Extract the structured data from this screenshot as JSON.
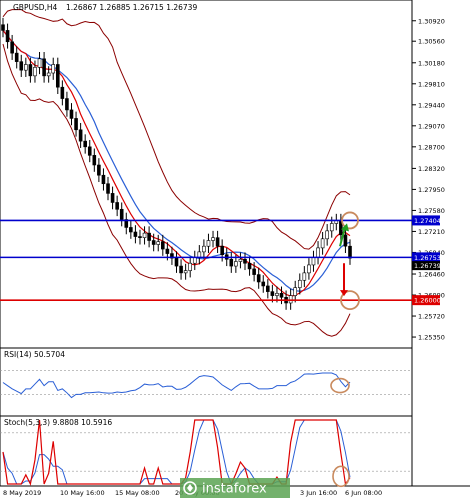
{
  "header": {
    "symbol": "GBPUSD,H4",
    "ohlc": "1.26867 1.26885 1.26715 1.26739"
  },
  "price_panel": {
    "ylim": [
      1.2521,
      1.3118
    ],
    "yticks": [
      "1.30920",
      "1.30560",
      "1.30180",
      "1.29810",
      "1.29440",
      "1.29070",
      "1.28700",
      "1.28320",
      "1.27950",
      "1.27580",
      "1.27210",
      "1.26840",
      "1.26460",
      "1.26090",
      "1.25720",
      "1.25350"
    ],
    "levels": [
      {
        "value": 1.27404,
        "label": "1.27404",
        "color": "#0000cc"
      },
      {
        "value": 1.26753,
        "label": "1.26753",
        "color": "#0000cc"
      },
      {
        "value": 1.26,
        "label": "1.26000",
        "color": "#dd0000"
      }
    ],
    "last_price_label": "1.26739",
    "colors": {
      "bollinger": "#8b0000",
      "ma_fast": "#dd0000",
      "ma_slow": "#2a5fd6",
      "candles": "#000000"
    }
  },
  "rsi_panel": {
    "label": "RSI(14) 50.5704",
    "ylim": [
      0,
      100
    ]
  },
  "stoch_panel": {
    "label": "Stoch(5,3,3) 9.8808 10.5916",
    "ylim": [
      0,
      100
    ],
    "colors": {
      "main": "#dd0000",
      "signal": "#2a5fd6"
    }
  },
  "x_axis": {
    "labels": [
      "8 May 2019",
      "10 May 16:00",
      "15 May 08:00",
      "20 May 00:00",
      "3 Jun 16:00",
      "6 Jun 08:00"
    ]
  },
  "watermark": {
    "text": "instaforex"
  },
  "chart_data": {
    "type": "candlestick",
    "symbol": "GBPUSD",
    "timeframe": "H4",
    "close_series": [
      1.3075,
      1.3055,
      1.3035,
      1.302,
      1.3005,
      1.3015,
      1.2995,
      1.301,
      1.3025,
      1.2995,
      1.3,
      1.3015,
      1.2975,
      1.2955,
      1.2935,
      1.292,
      1.29,
      1.288,
      1.287,
      1.2855,
      1.2838,
      1.282,
      1.2805,
      1.2788,
      1.2772,
      1.276,
      1.2742,
      1.2728,
      1.272,
      1.2712,
      1.271,
      1.2718,
      1.2705,
      1.2698,
      1.2703,
      1.269,
      1.2682,
      1.2674,
      1.266,
      1.2648,
      1.2652,
      1.2665,
      1.2675,
      1.2685,
      1.2695,
      1.2705,
      1.271,
      1.2695,
      1.268,
      1.2672,
      1.266,
      1.2668,
      1.2672,
      1.2665,
      1.2655,
      1.2645,
      1.2632,
      1.2625,
      1.2615,
      1.2608,
      1.2612,
      1.2605,
      1.2595,
      1.2608,
      1.2622,
      1.2635,
      1.2648,
      1.2662,
      1.2675,
      1.2692,
      1.2708,
      1.2722,
      1.2735,
      1.274,
      1.2715,
      1.2695,
      1.2674
    ],
    "rsi_value": 50.5704,
    "stoch_main": 9.8808,
    "stoch_signal": 10.5916
  }
}
